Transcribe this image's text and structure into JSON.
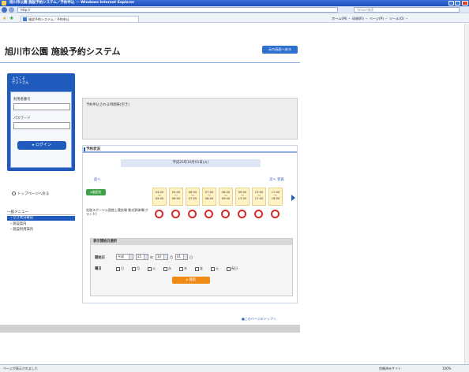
{
  "browser": {
    "window_title": "旭川市公園 施設予約システム／予約申込 － Windows Internet Explorer",
    "address": "http://",
    "search_placeholder": "Yahoo!検索",
    "tab_title": "施設予約システム／予約申込",
    "tools": "ホーム(M) ・ 印刷(R) ・ ページ(P) ・ ツール(O) ・",
    "status_left": "ページが表示されました",
    "status_zone": "信頼済みサイト",
    "status_zoom": "100%"
  },
  "header": {
    "site_title": "旭川市公園 施設予約システム",
    "return_button": "元の画面へ戻る"
  },
  "login": {
    "welcome": "ようこそ\nゲストさん",
    "user_id_label": "利用者番号",
    "password_label": "パスワード",
    "login_button": "▸ ログイン"
  },
  "sidebar": {
    "top_link": "トップページへ戻る",
    "menu_title": "一般メニュー",
    "items": [
      {
        "label": "・空き状況確認"
      },
      {
        "label": "・施設案内"
      },
      {
        "label": "・施設利用案内"
      }
    ]
  },
  "message": {
    "label": "予約申込される時間帯(空き)"
  },
  "status": {
    "title": "予約状況",
    "date": "平成25年10月01日(火)",
    "prev_link": "前へ",
    "next_link": "次へ 翌週",
    "avail_button": "▸施設別",
    "times": [
      {
        "start": "04:00",
        "end": "05:00"
      },
      {
        "start": "05:00",
        "end": "06:00"
      },
      {
        "start": "06:00",
        "end": "07:00"
      },
      {
        "start": "07:00",
        "end": "08:00"
      },
      {
        "start": "08:00",
        "end": "09:00"
      },
      {
        "start": "09:00",
        "end": "13:00"
      },
      {
        "start": "13:00",
        "end": "17:00"
      },
      {
        "start": "17:00",
        "end": "18:00"
      }
    ],
    "facility": "花咲スポーツ公園陸上競技場 軟式野球場(グランド)"
  },
  "form": {
    "title": "表示開始日選択",
    "start_label": "開始日",
    "era": "平成",
    "year": "25",
    "year_unit": "年",
    "month": "10",
    "month_unit": "月",
    "day": "01",
    "day_unit": "日",
    "weekday_label": "曜日",
    "weekdays": [
      "日",
      "月",
      "火",
      "水",
      "木",
      "金",
      "土",
      "祝日"
    ],
    "search_button": "▸ 検索"
  },
  "footer": {
    "pagetop_link": "■このページのトップへ"
  }
}
